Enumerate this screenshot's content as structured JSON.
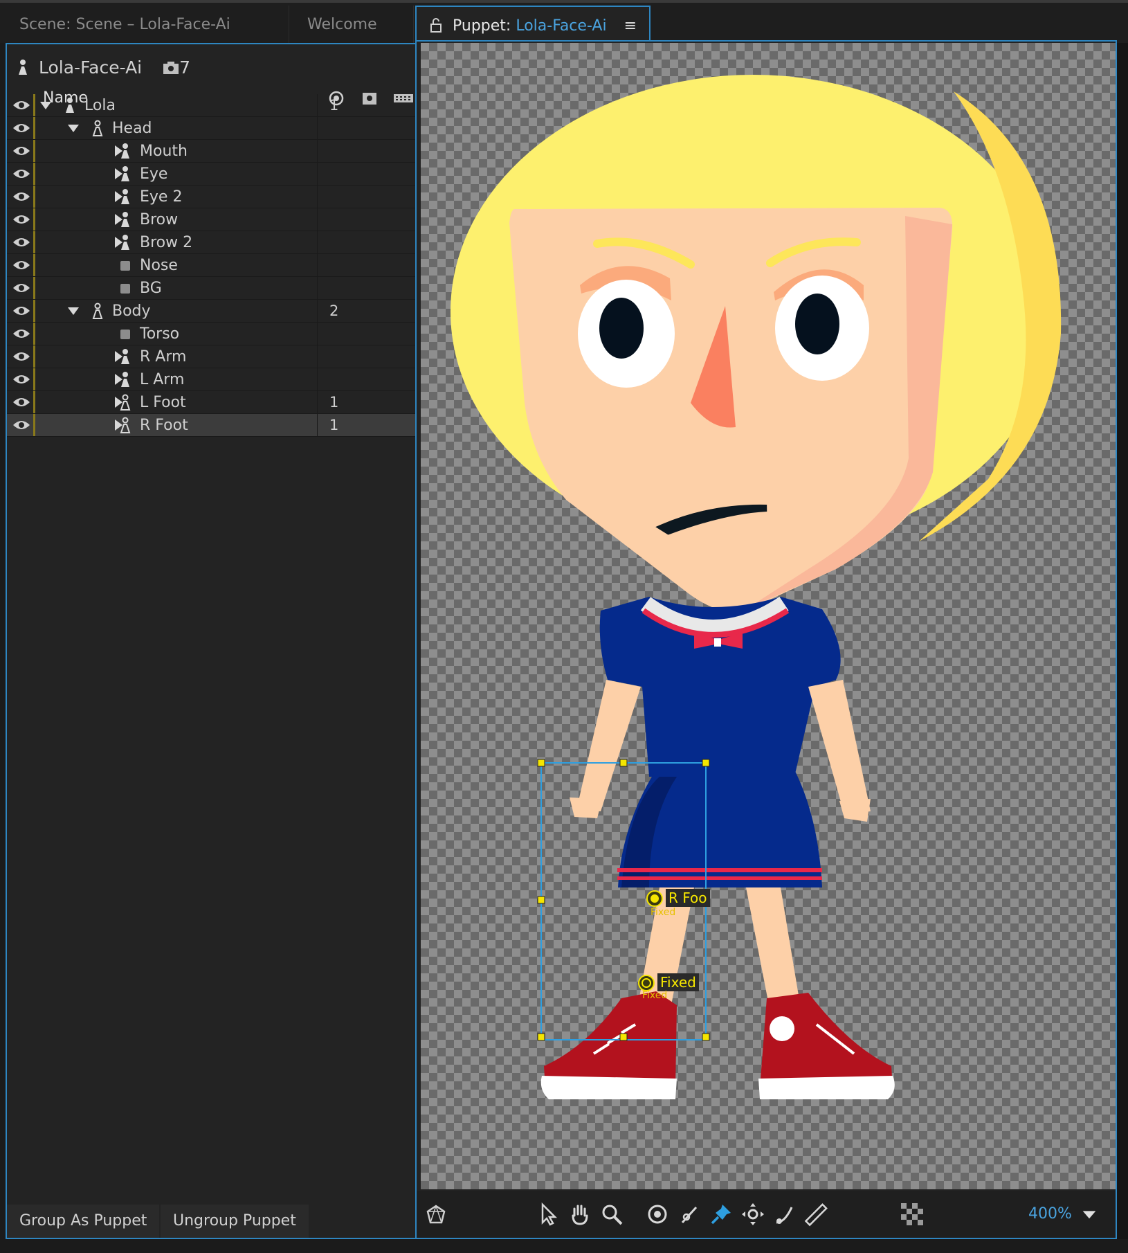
{
  "tabs": {
    "scene": "Scene: Scene – Lola-Face-Ai",
    "welcome": "Welcome",
    "puppet_prefix": "Puppet:",
    "puppet_name": "Lola-Face-Ai",
    "menu_glyph": "≡"
  },
  "panel": {
    "puppet_name": "Lola-Face-Ai",
    "count": "7",
    "col_name": "Name"
  },
  "rows": [
    {
      "label": "Lola",
      "num": "1"
    },
    {
      "label": "Head",
      "num": ""
    },
    {
      "label": "Mouth",
      "num": ""
    },
    {
      "label": "Eye",
      "num": ""
    },
    {
      "label": "Eye 2",
      "num": ""
    },
    {
      "label": "Brow",
      "num": ""
    },
    {
      "label": "Brow 2",
      "num": ""
    },
    {
      "label": "Nose",
      "num": ""
    },
    {
      "label": "BG",
      "num": ""
    },
    {
      "label": "Body",
      "num": "2"
    },
    {
      "label": "Torso",
      "num": ""
    },
    {
      "label": "R Arm",
      "num": ""
    },
    {
      "label": "L Arm",
      "num": ""
    },
    {
      "label": "L Foot",
      "num": "1"
    },
    {
      "label": "R Foot",
      "num": "1"
    }
  ],
  "buttons": {
    "group": "Group As Puppet",
    "ungroup": "Ungroup Puppet"
  },
  "handles": {
    "origin_label": "R Foo",
    "origin_sub": "Fixed",
    "fixed_label": "Fixed",
    "fixed_sub": "Fixed"
  },
  "zoom": "400%",
  "colors": {
    "accent": "#2e86c1",
    "handle": "#f5e600"
  }
}
